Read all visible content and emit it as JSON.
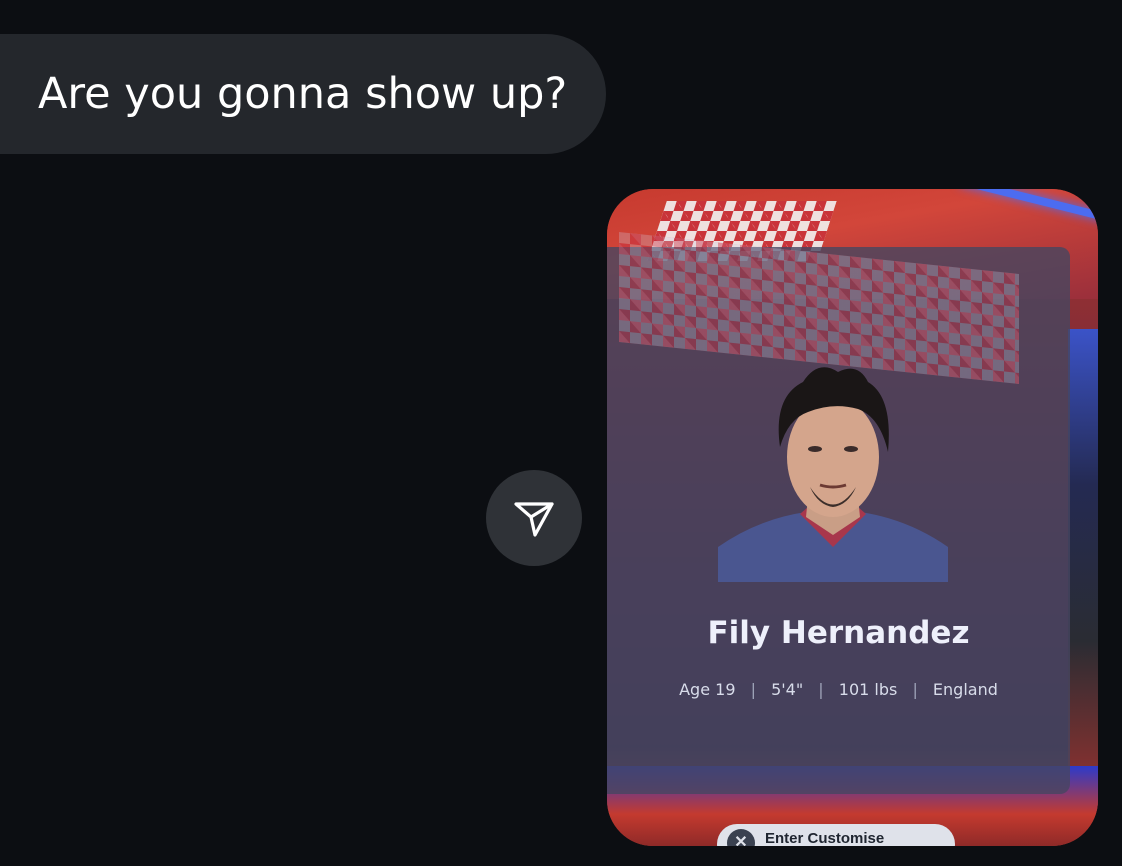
{
  "conversation": {
    "incoming_message": "Are you gonna show up?",
    "share_button": {
      "icon": "send-icon"
    },
    "photo": {
      "player_name": "Fily Hernandez",
      "age": "Age 19",
      "height": "5'4\"",
      "weight": "101 lbs",
      "country": "England",
      "separator": "|",
      "button_label": "Enter Customise",
      "button_icon": "x-icon"
    }
  },
  "colors": {
    "background": "#0c0e12",
    "bubble": "#24272c",
    "share_button": "#2f3237",
    "text": "#ffffff"
  }
}
